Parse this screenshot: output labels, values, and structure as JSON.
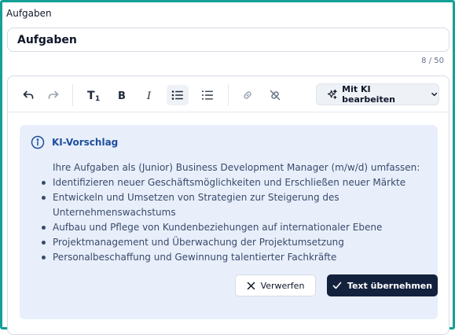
{
  "field": {
    "label": "Aufgaben",
    "value": "Aufgaben",
    "counter": "8 / 50"
  },
  "toolbar": {
    "ai_button_label": "Mit KI bearbeiten"
  },
  "suggestion": {
    "title": "KI-Vorschlag",
    "intro": "Ihre Aufgaben als (Junior) Business Development Manager (m/w/d) umfassen:",
    "items": [
      "Identifizieren neuer Geschäftsmöglichkeiten und Erschließen neuer Märkte",
      "Entwickeln und Umsetzen von Strategien zur Steigerung des Unternehmenswachstums",
      "Aufbau und Pflege von Kundenbeziehungen auf internationaler Ebene",
      "Projektmanagement und Überwachung der Projektumsetzung",
      "Personalbeschaffung und Gewinnung talentierter Fachkräfte"
    ],
    "discard_label": "Verwerfen",
    "accept_label": "Text übernehmen"
  },
  "colors": {
    "frame": "#14a096",
    "suggestion_bg": "#e8effb",
    "suggestion_title": "#1e4f9c",
    "primary_button": "#14213d"
  }
}
